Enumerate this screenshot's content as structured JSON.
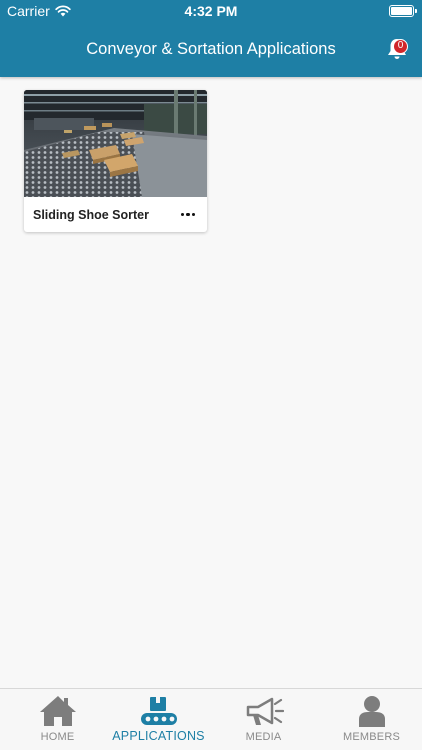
{
  "status_bar": {
    "carrier": "Carrier",
    "time": "4:32 PM"
  },
  "header": {
    "title": "Conveyor & Sortation Applications",
    "notification_count": "0"
  },
  "applications": [
    {
      "title": "Sliding Shoe Sorter",
      "image": "conveyor-photo"
    }
  ],
  "tabs": [
    {
      "label": "HOME",
      "icon": "home-icon",
      "active": false
    },
    {
      "label": "APPLICATIONS",
      "icon": "conveyor-icon",
      "active": true
    },
    {
      "label": "MEDIA",
      "icon": "megaphone-icon",
      "active": false
    },
    {
      "label": "MEMBERS",
      "icon": "person-icon",
      "active": false
    }
  ],
  "colors": {
    "primary": "#1e7fa5",
    "badge": "#d0262a",
    "inactive_tab": "#8a8a8a"
  }
}
